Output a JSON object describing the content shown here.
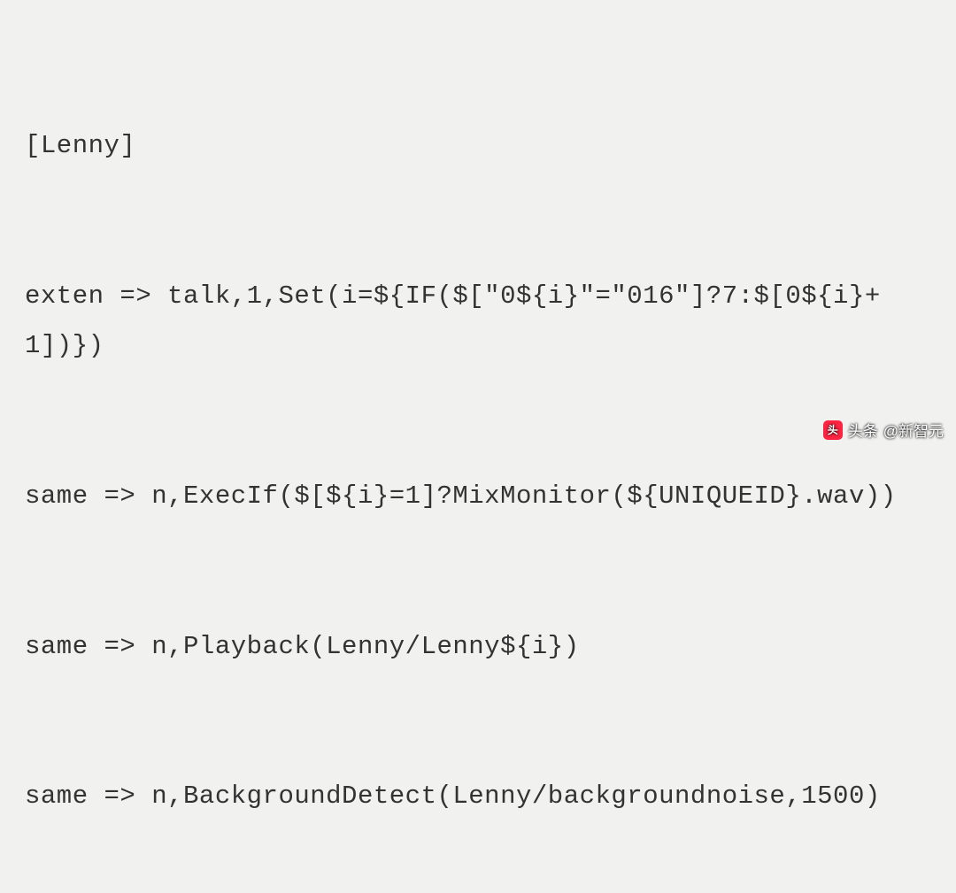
{
  "code": {
    "lines": [
      "[Lenny]",
      "exten => talk,1,Set(i=${IF($[\"0${i}\"=\"016\"]?7:$[0${i}+1])})",
      "same => n,ExecIf($[${i}=1]?MixMonitor(${UNIQUEID}.wav))",
      "same => n,Playback(Lenny/Lenny${i})",
      "same => n,BackgroundDetect(Lenny/backgroundnoise,1500)"
    ]
  },
  "watermark": {
    "prefix": "头条",
    "at": "@新智元",
    "icon_label": "头条"
  }
}
